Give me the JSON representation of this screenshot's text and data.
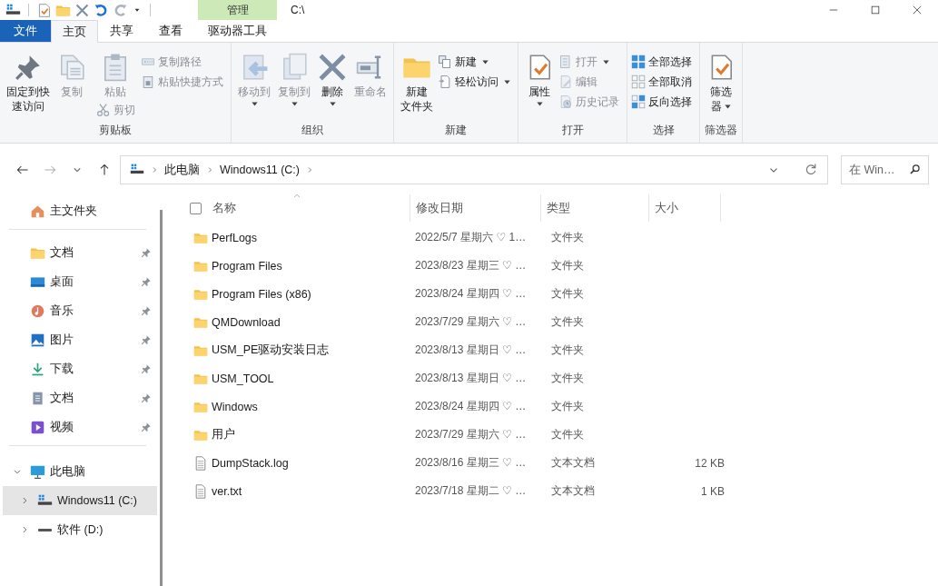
{
  "title_bar": {
    "context_group": "管理",
    "title": "C:\\"
  },
  "ribbon_tabs": [
    {
      "label": "文件",
      "kind": "file",
      "selected": false
    },
    {
      "label": "主页",
      "kind": "normal",
      "selected": true
    },
    {
      "label": "共享",
      "kind": "normal",
      "selected": false
    },
    {
      "label": "查看",
      "kind": "normal",
      "selected": false
    },
    {
      "label": "驱动器工具",
      "kind": "contextual",
      "selected": false
    }
  ],
  "ribbon_groups": [
    {
      "label": "剪贴板",
      "items": [
        {
          "kind": "large",
          "label": [
            "固定到快",
            "速访问"
          ],
          "disabled": false,
          "dropdown": false
        },
        {
          "kind": "large",
          "label": [
            "复制"
          ],
          "disabled": true,
          "dropdown": false
        },
        {
          "kind": "large",
          "label": [
            "粘贴"
          ],
          "disabled": true,
          "dropdown": false
        },
        {
          "kind": "under",
          "label": [
            "剪切"
          ],
          "disabled": true,
          "dropdown": false
        },
        {
          "kind": "small",
          "label": [
            "复制路径"
          ],
          "disabled": true,
          "dropdown": false
        },
        {
          "kind": "small",
          "label": [
            "粘贴快捷方式"
          ],
          "disabled": true,
          "dropdown": false
        }
      ]
    },
    {
      "label": "组织",
      "items": [
        {
          "kind": "large",
          "label": [
            "移动到"
          ],
          "disabled": true,
          "dropdown": true
        },
        {
          "kind": "large",
          "label": [
            "复制到"
          ],
          "disabled": true,
          "dropdown": true
        },
        {
          "kind": "large",
          "label": [
            "删除"
          ],
          "disabled": false,
          "dropdown": true
        },
        {
          "kind": "large",
          "label": [
            "重命名"
          ],
          "disabled": true,
          "dropdown": false
        }
      ]
    },
    {
      "label": "新建",
      "items": [
        {
          "kind": "large",
          "label": [
            "新建",
            "文件夹"
          ],
          "disabled": false,
          "dropdown": false
        },
        {
          "kind": "small",
          "label": [
            "新建"
          ],
          "disabled": false,
          "dropdown": true
        },
        {
          "kind": "small",
          "label": [
            "轻松访问"
          ],
          "disabled": false,
          "dropdown": true
        }
      ]
    },
    {
      "label": "打开",
      "items": [
        {
          "kind": "large",
          "label": [
            "属性"
          ],
          "disabled": false,
          "dropdown": true
        },
        {
          "kind": "small",
          "label": [
            "打开"
          ],
          "disabled": true,
          "dropdown": true
        },
        {
          "kind": "small",
          "label": [
            "编辑"
          ],
          "disabled": true,
          "dropdown": false
        },
        {
          "kind": "small",
          "label": [
            "历史记录"
          ],
          "disabled": true,
          "dropdown": false
        }
      ]
    },
    {
      "label": "选择",
      "items": [
        {
          "kind": "small",
          "label": [
            "全部选择"
          ],
          "disabled": false,
          "dropdown": false
        },
        {
          "kind": "small",
          "label": [
            "全部取消"
          ],
          "disabled": false,
          "dropdown": false
        },
        {
          "kind": "small",
          "label": [
            "反向选择"
          ],
          "disabled": false,
          "dropdown": false
        }
      ]
    },
    {
      "label": "筛选器",
      "items": [
        {
          "kind": "large",
          "label": [
            "筛选",
            "器"
          ],
          "disabled": false,
          "dropdown": true
        }
      ]
    }
  ],
  "navigation": {
    "back_disabled": false,
    "forward_disabled": true,
    "up_disabled": false
  },
  "address_bar": {
    "crumbs": [
      "此电脑",
      "Windows11 (C:)"
    ]
  },
  "search": {
    "placeholder": "在 Win…"
  },
  "sidebar": {
    "home": "主文件夹",
    "pinned": [
      {
        "label": "文档",
        "pinned": true
      },
      {
        "label": "桌面",
        "pinned": true
      },
      {
        "label": "音乐",
        "pinned": true
      },
      {
        "label": "图片",
        "pinned": true
      },
      {
        "label": "下载",
        "pinned": true
      },
      {
        "label": "文档",
        "pinned": true
      },
      {
        "label": "视频",
        "pinned": true
      }
    ],
    "tree": [
      {
        "label": "此电脑",
        "expanded": true,
        "selected": false,
        "children": [
          {
            "label": "Windows11 (C:)",
            "expanded": false,
            "selected": true
          },
          {
            "label": "软件 (D:)",
            "expanded": false,
            "selected": false
          }
        ]
      }
    ]
  },
  "table": {
    "select_all_checked": false,
    "columns": [
      "名称",
      "修改日期",
      "类型",
      "大小"
    ],
    "rows": [
      {
        "kind": "folder",
        "name": "PerfLogs",
        "date": "2022/5/7 星期六 ♡ 1…",
        "type": "文件夹"
      },
      {
        "kind": "folder",
        "name": "Program Files",
        "date": "2023/8/23 星期三 ♡ …",
        "type": "文件夹"
      },
      {
        "kind": "folder",
        "name": "Program Files (x86)",
        "date": "2023/8/24 星期四 ♡ …",
        "type": "文件夹"
      },
      {
        "kind": "folder",
        "name": "QMDownload",
        "date": "2023/7/29 星期六 ♡ …",
        "type": "文件夹"
      },
      {
        "kind": "folder",
        "name": "USM_PE驱动安装日志",
        "date": "2023/8/13 星期日 ♡ …",
        "type": "文件夹"
      },
      {
        "kind": "folder",
        "name": "USM_TOOL",
        "date": "2023/8/13 星期日 ♡ …",
        "type": "文件夹"
      },
      {
        "kind": "folder",
        "name": "Windows",
        "date": "2023/8/24 星期四 ♡ …",
        "type": "文件夹"
      },
      {
        "kind": "folder",
        "name": "用户",
        "date": "2023/7/29 星期六 ♡ …",
        "type": "文件夹"
      },
      {
        "kind": "file",
        "name": "DumpStack.log",
        "date": "2023/8/16 星期三 ♡ …",
        "type": "文本文档",
        "size": "12 KB"
      },
      {
        "kind": "file",
        "name": "ver.txt",
        "date": "2023/7/18 星期二 ♡ …",
        "type": "文本文档",
        "size": "1 KB"
      }
    ]
  }
}
